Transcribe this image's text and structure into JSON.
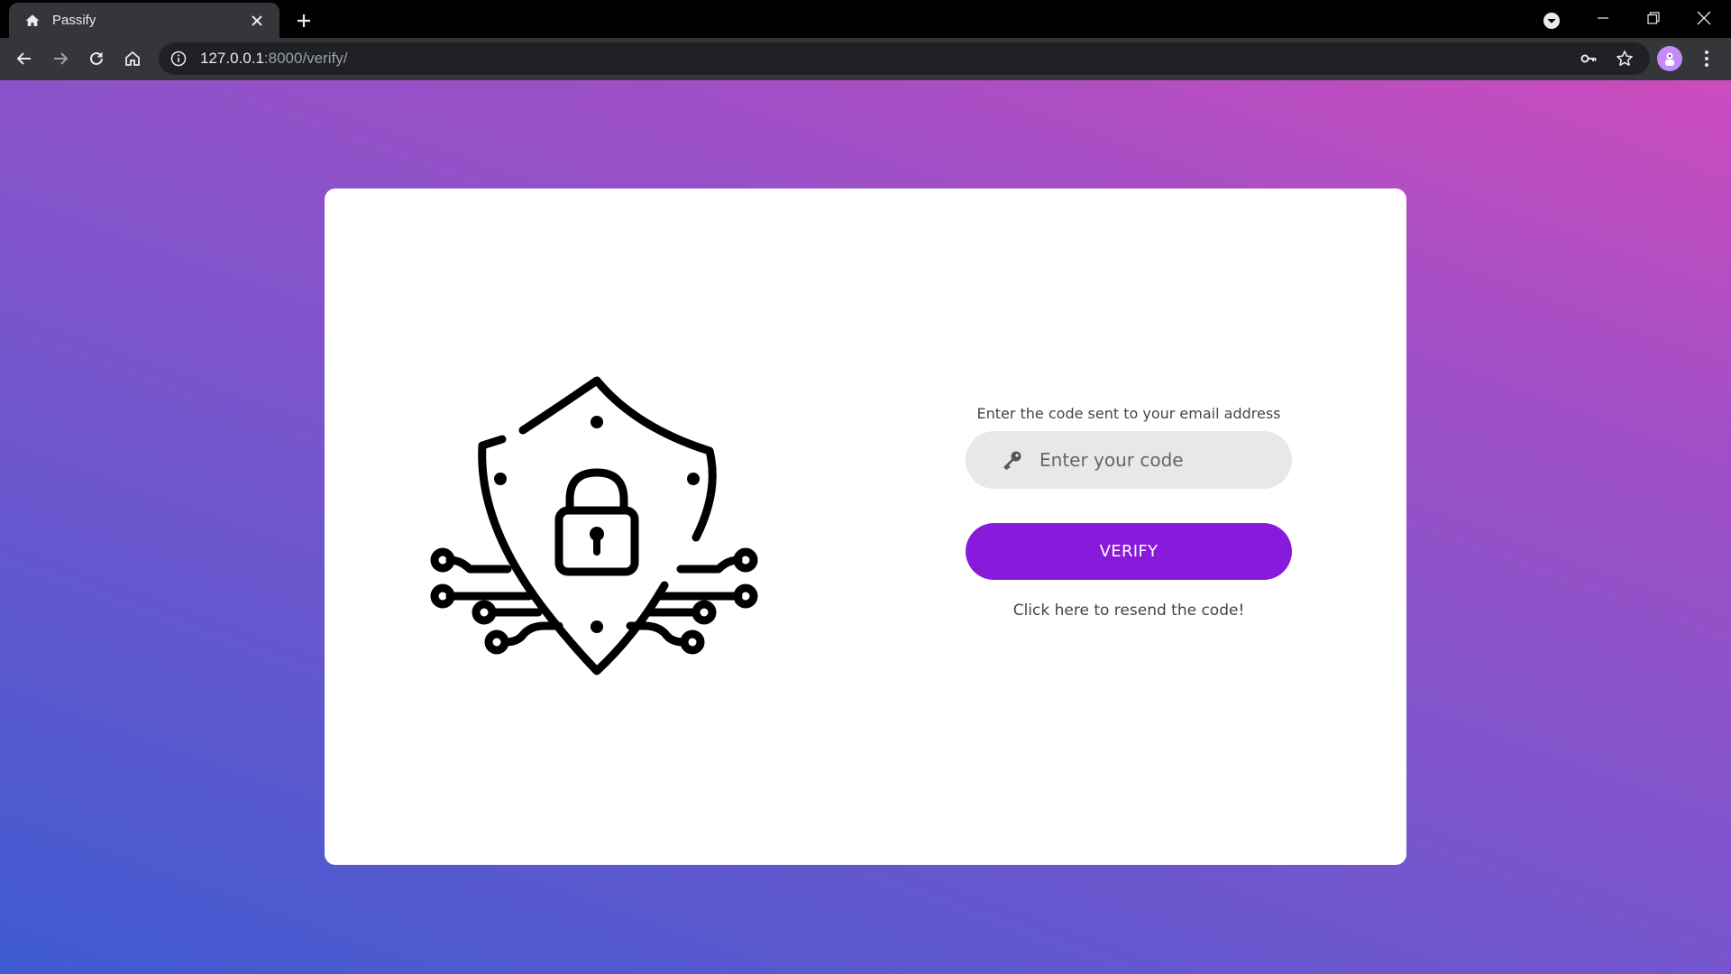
{
  "browser": {
    "tab_title": "Passify",
    "url_host": "127.0.0.1",
    "url_rest": ":8000/verify/"
  },
  "verify": {
    "prompt": "Enter the code sent to your email address",
    "code_placeholder": "Enter your code",
    "code_value": "",
    "verify_label": "VERIFY",
    "resend_label": "Click here to resend the code!"
  },
  "colors": {
    "accent": "#8a1adb",
    "gradient_start": "#3e5bd1",
    "gradient_end": "#cc4cbd",
    "card": "#ffffff",
    "input_bg": "#e8e8e8"
  },
  "icons": {
    "favicon": "home-icon",
    "illustration": "shield-lock-circuit-icon",
    "field_icon": "key-icon"
  }
}
